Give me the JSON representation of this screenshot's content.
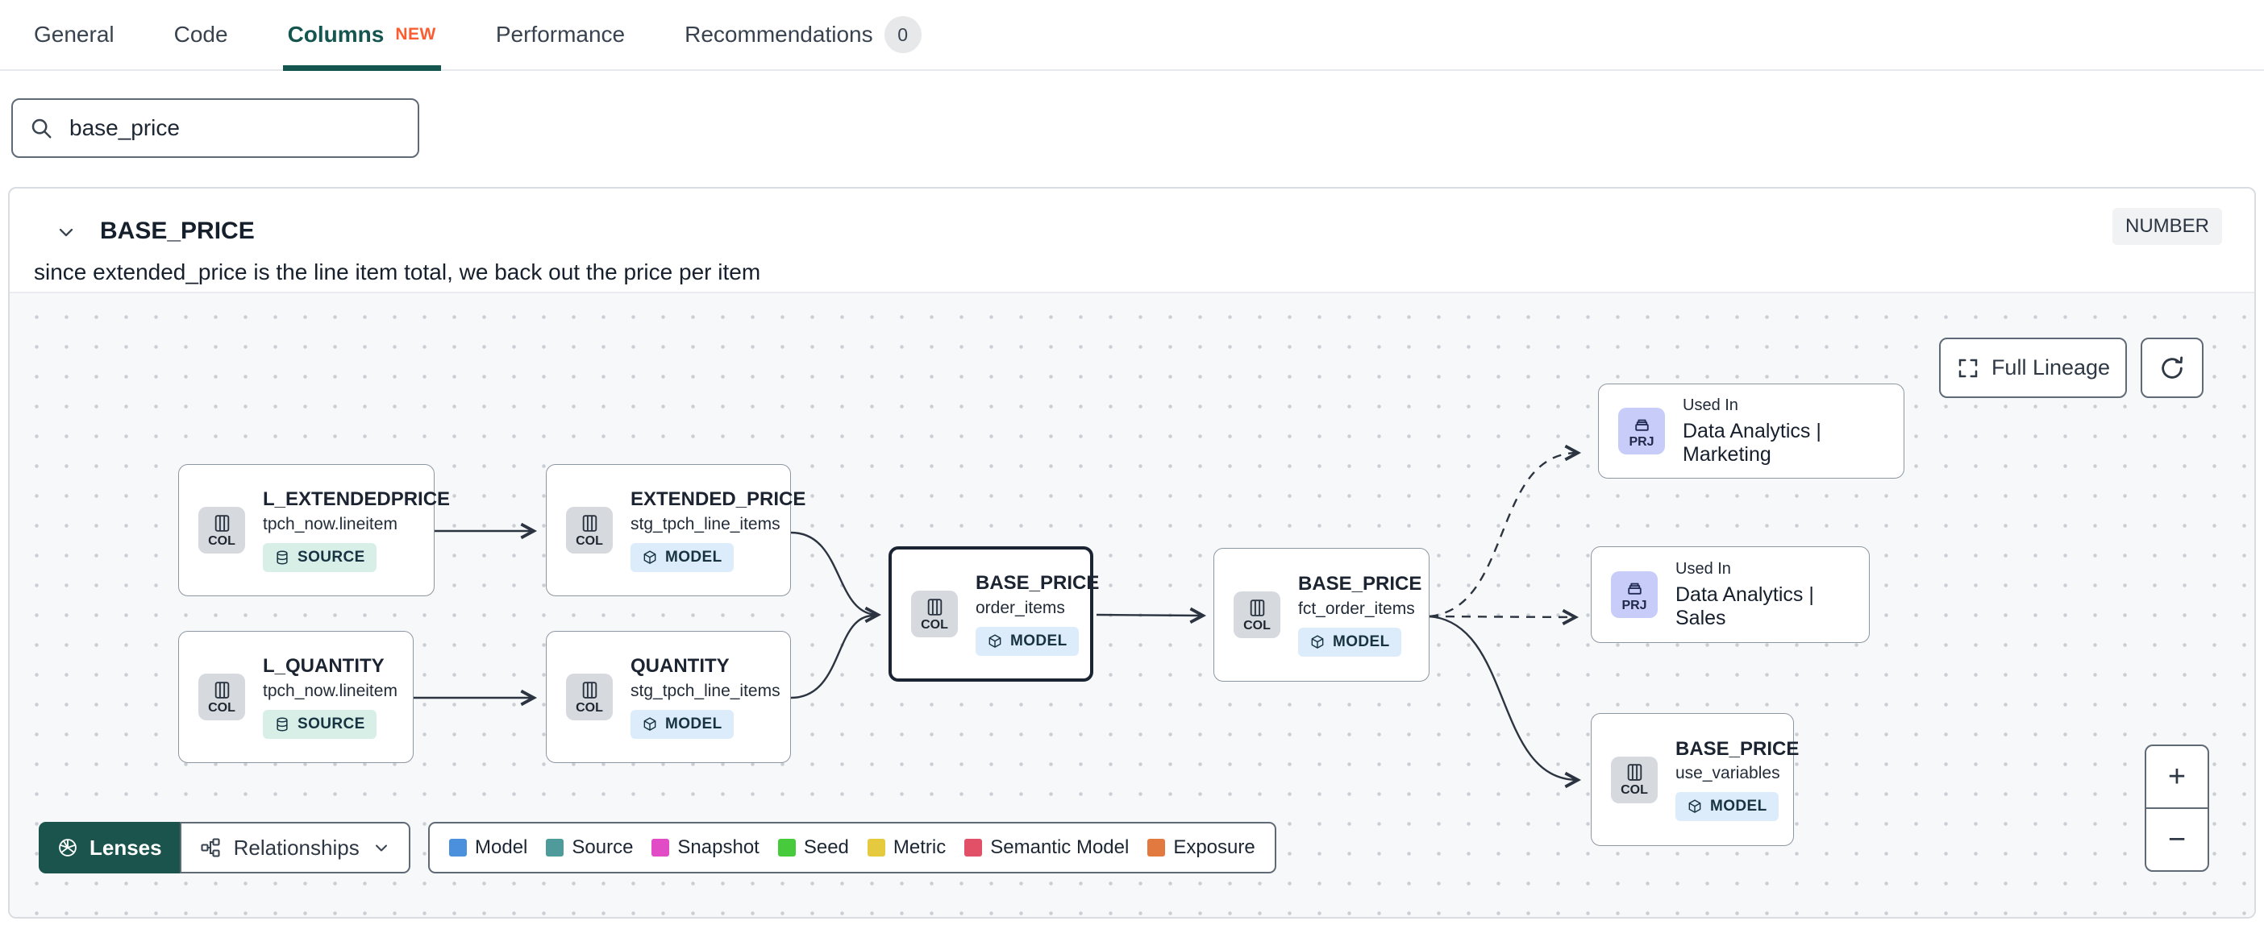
{
  "tabs": {
    "items": [
      {
        "label": "General"
      },
      {
        "label": "Code"
      },
      {
        "label": "Columns",
        "badge": "NEW"
      },
      {
        "label": "Performance"
      },
      {
        "label": "Recommendations",
        "count": "0"
      }
    ]
  },
  "search": {
    "value": "base_price"
  },
  "column_panel": {
    "name": "BASE_PRICE",
    "type": "NUMBER",
    "description": "since extended_price is the line item total, we back out the price per item"
  },
  "lineage": {
    "controls": {
      "full_lineage": "Full Lineage",
      "zoom_in": "+",
      "zoom_out": "−"
    },
    "toolbar": {
      "lenses": "Lenses",
      "relationships": "Relationships"
    },
    "legend": [
      {
        "label": "Model",
        "color": "#4a90dd"
      },
      {
        "label": "Source",
        "color": "#4f9a9b"
      },
      {
        "label": "Snapshot",
        "color": "#e14bc6"
      },
      {
        "label": "Seed",
        "color": "#47cb3d"
      },
      {
        "label": "Metric",
        "color": "#e5c93f"
      },
      {
        "label": "Semantic Model",
        "color": "#e25067"
      },
      {
        "label": "Exposure",
        "color": "#e27a3f"
      }
    ],
    "nodes": [
      {
        "kind": "COL",
        "title": "L_EXTENDEDPRICE",
        "subtitle": "tpch_now.lineitem",
        "badge": "SOURCE"
      },
      {
        "kind": "COL",
        "title": "EXTENDED_PRICE",
        "subtitle": "stg_tpch_line_items",
        "badge": "MODEL"
      },
      {
        "kind": "COL",
        "title": "L_QUANTITY",
        "subtitle": "tpch_now.lineitem",
        "badge": "SOURCE"
      },
      {
        "kind": "COL",
        "title": "QUANTITY",
        "subtitle": "stg_tpch_line_items",
        "badge": "MODEL"
      },
      {
        "kind": "COL",
        "title": "BASE_PRICE",
        "subtitle": "order_items",
        "badge": "MODEL"
      },
      {
        "kind": "COL",
        "title": "BASE_PRICE",
        "subtitle": "fct_order_items",
        "badge": "MODEL"
      },
      {
        "kind": "PRJ",
        "title": "Used In",
        "subtitle": "Data Analytics | Marketing"
      },
      {
        "kind": "PRJ",
        "title": "Used In",
        "subtitle": "Data Analytics | Sales"
      },
      {
        "kind": "COL",
        "title": "BASE_PRICE",
        "subtitle": "use_variables",
        "badge": "MODEL"
      }
    ]
  }
}
